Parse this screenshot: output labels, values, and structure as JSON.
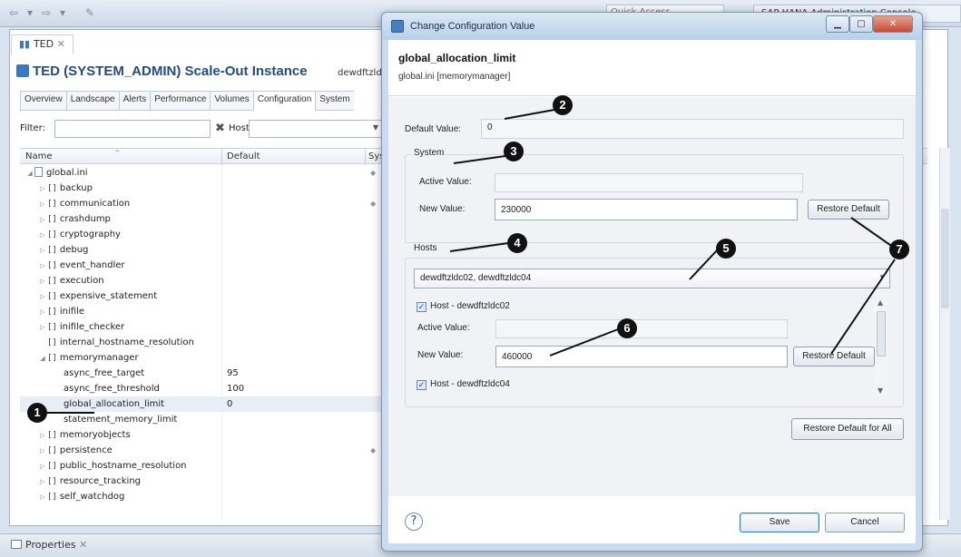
{
  "workbench": {
    "quick_access": "Quick Access",
    "perspective": "SAP HANA Administration Console",
    "editor_tab": "TED",
    "instance_title": "TED (SYSTEM_ADMIN) Scale-Out Instance",
    "instance_host": "dewdftzld",
    "tabs": [
      "Overview",
      "Landscape",
      "Alerts",
      "Performance",
      "Volumes",
      "Configuration",
      "System"
    ],
    "active_tab": "Configuration",
    "filter_label": "Filter:",
    "host_label": "Host:",
    "columns": {
      "name": "Name",
      "default": "Default",
      "system": "Sys"
    },
    "props_tab": "Properties"
  },
  "tree": [
    {
      "label": "global.ini",
      "indent": 0,
      "twisty": "open",
      "kind": "file",
      "default": "",
      "dia": true
    },
    {
      "label": "backup",
      "indent": 1,
      "twisty": "closed",
      "kind": "section",
      "default": "",
      "dia": false
    },
    {
      "label": "communication",
      "indent": 1,
      "twisty": "closed",
      "kind": "section",
      "default": "",
      "dia": true
    },
    {
      "label": "crashdump",
      "indent": 1,
      "twisty": "closed",
      "kind": "section",
      "default": "",
      "dia": false
    },
    {
      "label": "cryptography",
      "indent": 1,
      "twisty": "closed",
      "kind": "section",
      "default": "",
      "dia": false
    },
    {
      "label": "debug",
      "indent": 1,
      "twisty": "closed",
      "kind": "section",
      "default": "",
      "dia": false
    },
    {
      "label": "event_handler",
      "indent": 1,
      "twisty": "closed",
      "kind": "section",
      "default": "",
      "dia": false
    },
    {
      "label": "execution",
      "indent": 1,
      "twisty": "closed",
      "kind": "section",
      "default": "",
      "dia": false
    },
    {
      "label": "expensive_statement",
      "indent": 1,
      "twisty": "closed",
      "kind": "section",
      "default": "",
      "dia": false
    },
    {
      "label": "inifile",
      "indent": 1,
      "twisty": "closed",
      "kind": "section",
      "default": "",
      "dia": false
    },
    {
      "label": "inifile_checker",
      "indent": 1,
      "twisty": "closed",
      "kind": "section",
      "default": "",
      "dia": false
    },
    {
      "label": "internal_hostname_resolution",
      "indent": 1,
      "twisty": "none",
      "kind": "section",
      "default": "",
      "dia": false
    },
    {
      "label": "memorymanager",
      "indent": 1,
      "twisty": "open",
      "kind": "section",
      "default": "",
      "dia": false
    },
    {
      "label": "async_free_target",
      "indent": 3,
      "twisty": "none",
      "kind": "param",
      "default": "95",
      "dia": false
    },
    {
      "label": "async_free_threshold",
      "indent": 3,
      "twisty": "none",
      "kind": "param",
      "default": "100",
      "dia": false
    },
    {
      "label": "global_allocation_limit",
      "indent": 3,
      "twisty": "none",
      "kind": "param",
      "default": "0",
      "dia": false,
      "selected": true
    },
    {
      "label": "statement_memory_limit",
      "indent": 3,
      "twisty": "none",
      "kind": "param",
      "default": "",
      "dia": false
    },
    {
      "label": "memoryobjects",
      "indent": 1,
      "twisty": "closed",
      "kind": "section",
      "default": "",
      "dia": false
    },
    {
      "label": "persistence",
      "indent": 1,
      "twisty": "closed",
      "kind": "section",
      "default": "",
      "dia": true
    },
    {
      "label": "public_hostname_resolution",
      "indent": 1,
      "twisty": "closed",
      "kind": "section",
      "default": "",
      "dia": false
    },
    {
      "label": "resource_tracking",
      "indent": 1,
      "twisty": "closed",
      "kind": "section",
      "default": "",
      "dia": false
    },
    {
      "label": "self_watchdog",
      "indent": 1,
      "twisty": "closed",
      "kind": "section",
      "default": "",
      "dia": false
    }
  ],
  "dialog": {
    "title": "Change Configuration Value",
    "param_name": "global_allocation_limit",
    "param_file": "global.ini [memorymanager]",
    "default_value_label": "Default Value:",
    "default_value": "0",
    "system_group": "System",
    "active_value_label": "Active Value:",
    "system_active_value": "",
    "new_value_label": "New Value:",
    "system_new_value": "230000",
    "restore_default": "Restore Default",
    "hosts_group": "Hosts",
    "hosts_combo": "dewdftzldc02, dewdftzldc04",
    "host1_label": "Host - dewdftzldc02",
    "host1_checked": true,
    "host1_active_value": "",
    "host1_new_value": "460000",
    "host2_label": "Host - dewdftzldc04",
    "host2_checked": true,
    "restore_all": "Restore Default for All",
    "help": "?",
    "save": "Save",
    "cancel": "Cancel"
  },
  "callouts": [
    "1",
    "2",
    "3",
    "4",
    "5",
    "6",
    "7"
  ]
}
